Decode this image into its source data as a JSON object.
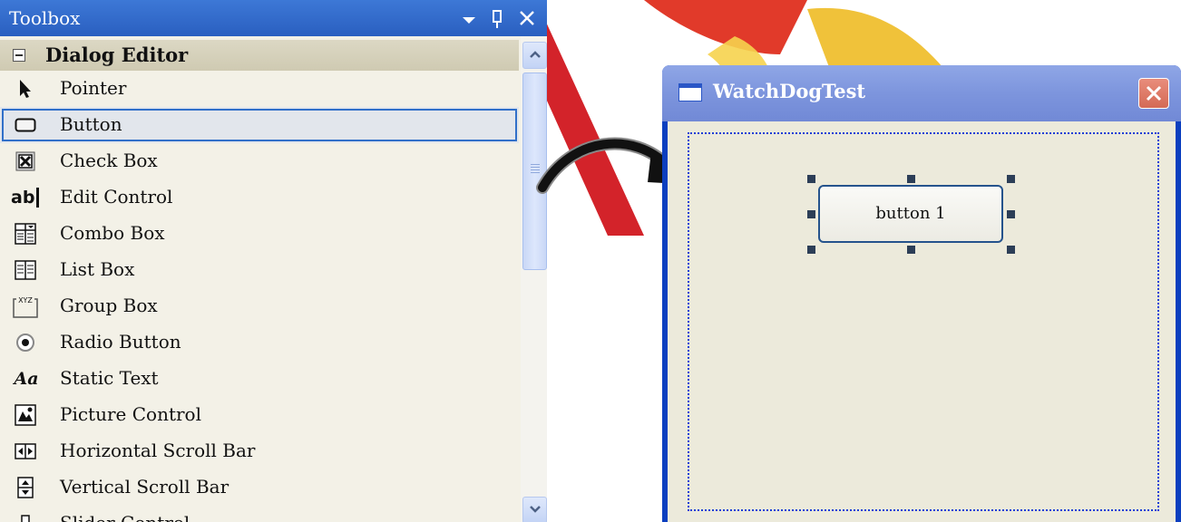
{
  "toolbox": {
    "title": "Toolbox",
    "controls": {
      "dropdown_icon": "dropdown-arrow-icon",
      "pin_icon": "pin-icon",
      "close_icon": "close-icon"
    },
    "category": "Dialog Editor",
    "selected_item": "Button",
    "items": [
      {
        "label": "Pointer",
        "icon": "pointer-icon"
      },
      {
        "label": "Button",
        "icon": "button-icon"
      },
      {
        "label": "Check Box",
        "icon": "check-box-icon"
      },
      {
        "label": "Edit Control",
        "icon": "edit-control-icon"
      },
      {
        "label": "Combo Box",
        "icon": "combo-box-icon"
      },
      {
        "label": "List Box",
        "icon": "list-box-icon"
      },
      {
        "label": "Group Box",
        "icon": "group-box-icon"
      },
      {
        "label": "Radio Button",
        "icon": "radio-button-icon"
      },
      {
        "label": "Static Text",
        "icon": "static-text-icon"
      },
      {
        "label": "Picture Control",
        "icon": "picture-control-icon"
      },
      {
        "label": "Horizontal Scroll Bar",
        "icon": "horizontal-scroll-bar-icon"
      },
      {
        "label": "Vertical Scroll Bar",
        "icon": "vertical-scroll-bar-icon"
      },
      {
        "label": "Slider Control",
        "icon": "slider-control-icon"
      }
    ],
    "edit_icon_text": "ab",
    "static_icon_text": "Aa",
    "group_icon_text": "XYZ"
  },
  "dialog": {
    "title": "WatchDogTest",
    "button_label": "button 1"
  },
  "colors": {
    "toolbox_title": "#2f66c8",
    "selection_outline": "#3170c9",
    "dialog_frame": "#0b3fbf",
    "close_button": "#d86d58"
  }
}
